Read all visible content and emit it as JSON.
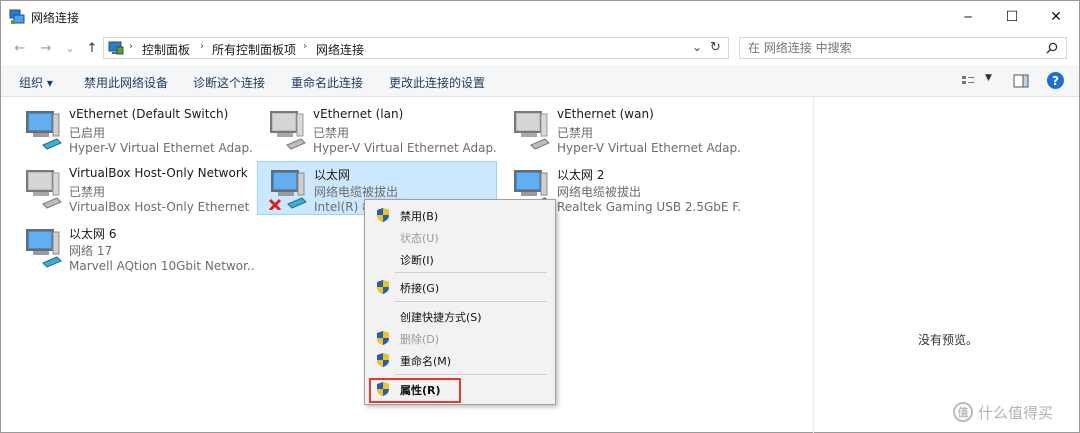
{
  "window": {
    "title": "网络连接",
    "minimize": "─",
    "maximize": "☐",
    "close": "✕"
  },
  "nav": {
    "back": "←",
    "forward": "→",
    "recent": "⌄",
    "up": "↑",
    "breadcrumbs": [
      "控制面板",
      "所有控制面板项",
      "网络连接"
    ],
    "breadcrumb_sep": "›",
    "search_placeholder": "在 网络连接 中搜索"
  },
  "commands": {
    "organize": "组织 ▾",
    "disable_device": "禁用此网络设备",
    "diagnose": "诊断这个连接",
    "rename": "重命名此连接",
    "change_settings": "更改此连接的设置"
  },
  "connections": [
    {
      "name": "vEthernet (Default Switch)",
      "status": "已启用",
      "device": "Hyper-V Virtual Ethernet Adap..."
    },
    {
      "name": "vEthernet (lan)",
      "status": "已禁用",
      "device": "Hyper-V Virtual Ethernet Adap..."
    },
    {
      "name": "vEthernet (wan)",
      "status": "已禁用",
      "device": "Hyper-V Virtual Ethernet Adap..."
    },
    {
      "name": "VirtualBox Host-Only Network",
      "status": "已禁用",
      "device": "VirtualBox Host-Only Ethernet ..."
    },
    {
      "name": "以太网",
      "status": "网络电缆被拔出",
      "device": "Intel(R) 8"
    },
    {
      "name": "以太网 2",
      "status": "网络电缆被拔出",
      "device": "Realtek Gaming USB 2.5GbE F..."
    },
    {
      "name": "以太网 6",
      "status": "网络 17",
      "device": "Marvell AQtion 10Gbit Networ..."
    }
  ],
  "context_menu": {
    "items": [
      {
        "label": "禁用(B)",
        "shield": true,
        "disabled": false
      },
      {
        "label": "状态(U)",
        "shield": false,
        "disabled": true
      },
      {
        "label": "诊断(I)",
        "shield": false,
        "disabled": false
      },
      {
        "label": "桥接(G)",
        "shield": true,
        "disabled": false
      },
      {
        "label": "创建快捷方式(S)",
        "shield": false,
        "disabled": false
      },
      {
        "label": "删除(D)",
        "shield": true,
        "disabled": true
      },
      {
        "label": "重命名(M)",
        "shield": true,
        "disabled": false
      },
      {
        "label": "属性(R)",
        "shield": true,
        "disabled": false
      }
    ],
    "highlight_color": "#e8392a"
  },
  "preview": {
    "text": "没有预览。"
  },
  "watermark": {
    "logo": "值",
    "text": "什么值得买"
  },
  "colors": {
    "selection_bg": "#cce8ff",
    "selection_border": "#99d1ff",
    "help_blue": "#1d6fd6"
  }
}
